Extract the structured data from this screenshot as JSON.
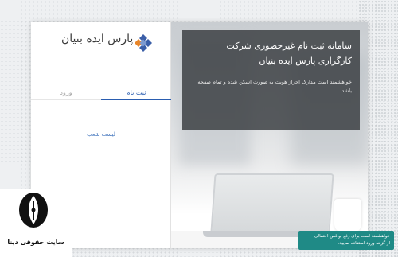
{
  "logo": {
    "text": "پارس ایده بنیان",
    "icon": "diamond-logo-icon"
  },
  "tabs": {
    "login": "ورود",
    "register": "ثبت نام"
  },
  "branch_list": "لیست شعب",
  "info": {
    "title": "سامانه ثبت نام غیرحضوری شرکت کارگزاری پارس ایده بنیان",
    "description": "خواهشمند است مدارک احراز هویت به صورت اسکن شده و تمام صفحه باشد."
  },
  "toast": {
    "line1": "خواهشمند است برای رفع نواقص احتمالی",
    "line2": "از گزینه ورود استفاده نمایید."
  },
  "watermark": {
    "text": "سایت حقوقی دینا"
  },
  "colors": {
    "accent": "#2a5db0",
    "toast": "#1f8a86",
    "logo_blue": "#3b5fa8",
    "logo_orange": "#e8862a"
  }
}
